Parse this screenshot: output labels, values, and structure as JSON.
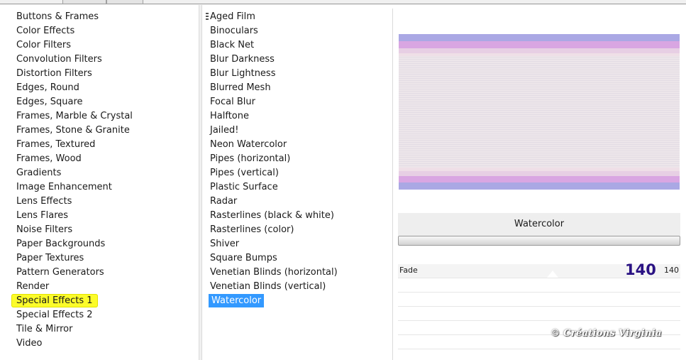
{
  "categories": [
    "Buttons & Frames",
    "Color Effects",
    "Color Filters",
    "Convolution Filters",
    "Distortion Filters",
    "Edges, Round",
    "Edges, Square",
    "Frames, Marble & Crystal",
    "Frames, Stone & Granite",
    "Frames, Textured",
    "Frames, Wood",
    "Gradients",
    "Image Enhancement",
    "Lens Effects",
    "Lens Flares",
    "Noise Filters",
    "Paper Backgrounds",
    "Paper Textures",
    "Pattern Generators",
    "Render",
    "Special Effects 1",
    "Special Effects 2",
    "Tile & Mirror",
    "Video"
  ],
  "selected_category": "Special Effects 1",
  "effects": [
    "Aged Film",
    "Binoculars",
    "Black Net",
    "Blur Darkness",
    "Blur Lightness",
    "Blurred Mesh",
    "Focal Blur",
    "Halftone",
    "Jailed!",
    "Neon Watercolor",
    "Pipes (horizontal)",
    "Pipes (vertical)",
    "Plastic Surface",
    "Radar",
    "Rasterlines (black & white)",
    "Rasterlines (color)",
    "Shiver",
    "Square Bumps",
    "Venetian Blinds (horizontal)",
    "Venetian Blinds (vertical)",
    "Watercolor"
  ],
  "selected_effect": "Watercolor",
  "filter_panel": {
    "title": "Watercolor",
    "param": {
      "name": "Fade",
      "value": "140",
      "value_small": "140"
    }
  },
  "watermark": "© Créations Virginia",
  "colors": {
    "category_highlight": "#fcfc2a",
    "effect_highlight": "#3399ff",
    "param_value": "#2a1283"
  }
}
